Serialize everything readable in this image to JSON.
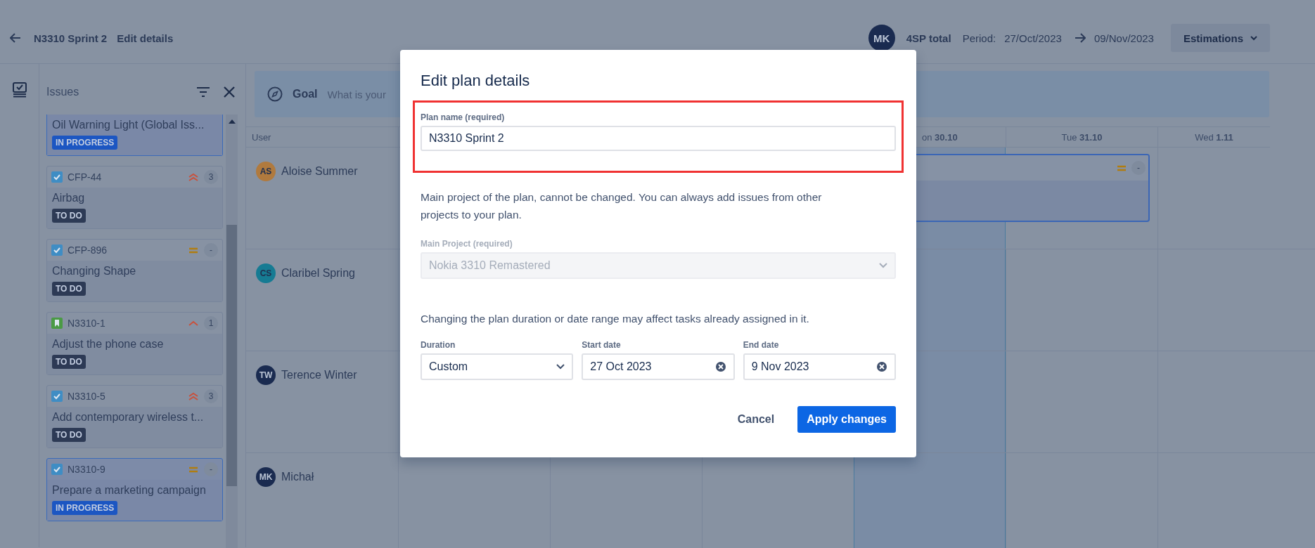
{
  "topbar": {
    "plan_name": "N3310 Sprint 2",
    "page": "Edit details",
    "avatar": {
      "initials": "MK",
      "color": "#1a2b50"
    },
    "total": "4SP total",
    "period_label": "Period:",
    "start": "27/Oct/2023",
    "end": "09/Nov/2023",
    "estimations_button": "Estimations"
  },
  "issues_panel": {
    "title": "Issues",
    "cards": [
      {
        "title": "Oil Warning Light (Global Iss...",
        "status": {
          "label": "IN PROGRESS",
          "color": "#1c56c2"
        },
        "selected": true
      },
      {
        "key": "CFP-44",
        "type_icon": {
          "kind": "task"
        },
        "priority_icon": {
          "kind": "highest"
        },
        "points": "3",
        "title": "Airbag",
        "status": {
          "label": "TO DO",
          "color": "#2d3a55"
        },
        "selected": false
      },
      {
        "key": "CFP-896",
        "type_icon": {
          "kind": "task"
        },
        "priority_icon": {
          "kind": "medium"
        },
        "points": "-",
        "title": "Changing Shape",
        "status": {
          "label": "TO DO",
          "color": "#2d3a55"
        },
        "selected": false
      },
      {
        "key": "N3310-1",
        "type_icon": {
          "kind": "story"
        },
        "priority_icon": {
          "kind": "high"
        },
        "points": "1",
        "title": "Adjust the phone case",
        "status": {
          "label": "TO DO",
          "color": "#2d3a55"
        },
        "selected": false
      },
      {
        "key": "N3310-5",
        "type_icon": {
          "kind": "task"
        },
        "priority_icon": {
          "kind": "highest"
        },
        "points": "3",
        "title": "Add contemporary wireless t...",
        "status": {
          "label": "TO DO",
          "color": "#2d3a55"
        },
        "selected": false
      },
      {
        "key": "N3310-9",
        "type_icon": {
          "kind": "task"
        },
        "priority_icon": {
          "kind": "medium"
        },
        "points": "-",
        "title": "Prepare a marketing campaign",
        "status": {
          "label": "IN PROGRESS",
          "color": "#1c56c2"
        },
        "selected": true
      }
    ]
  },
  "goal": {
    "label": "Goal",
    "placeholder": "What is your"
  },
  "calendar": {
    "user_column": "User",
    "days": [
      {
        "today": false
      },
      {
        "today": false
      },
      {
        "today": false
      },
      {
        "label": "on **30.10**",
        "cut": true,
        "today": true
      },
      {
        "label": "Tue **31.10**",
        "cut": false,
        "today": false
      },
      {
        "label": "Wed **1.11**",
        "cut": false,
        "today": false
      }
    ],
    "rows": [
      {
        "initials": "AS",
        "name": "Aloise Summer",
        "color": "#b07a3e",
        "tasks": [
          {
            "priority_icon": {
              "kind": "medium"
            },
            "points": "-",
            "selected": true
          }
        ]
      },
      {
        "initials": "CS",
        "name": "Claribel Spring",
        "color": "#167b93",
        "tasks": []
      },
      {
        "initials": "TW",
        "name": "Terence Winter",
        "color": "#1a2b50",
        "tasks": []
      },
      {
        "initials": "MK",
        "name": "Michał",
        "color": "#1a2b50",
        "tasks": []
      }
    ]
  },
  "dialog": {
    "title": "Edit plan details",
    "plan_name": {
      "label": "Plan name (required)",
      "value": "N3310 Sprint 2",
      "highlighted": true
    },
    "note": "Main project of the plan, cannot be changed. You can always add issues from other projects to your plan.",
    "main_project": {
      "label": "Main Project (required)",
      "value": "Nokia 3310 Remastered",
      "disabled": true
    },
    "range_note": "Changing the plan duration or date range may affect tasks already assigned in it.",
    "fields": [
      {
        "kind": "select",
        "label": "Duration",
        "value": "Custom"
      },
      {
        "kind": "date",
        "label": "Start date",
        "value": "27 Oct 2023"
      },
      {
        "kind": "date",
        "label": "End date",
        "value": "9 Nov 2023"
      }
    ],
    "buttons": [
      {
        "kind": "subtle",
        "label": "Cancel"
      },
      {
        "kind": "primary",
        "label": "Apply changes"
      }
    ]
  }
}
